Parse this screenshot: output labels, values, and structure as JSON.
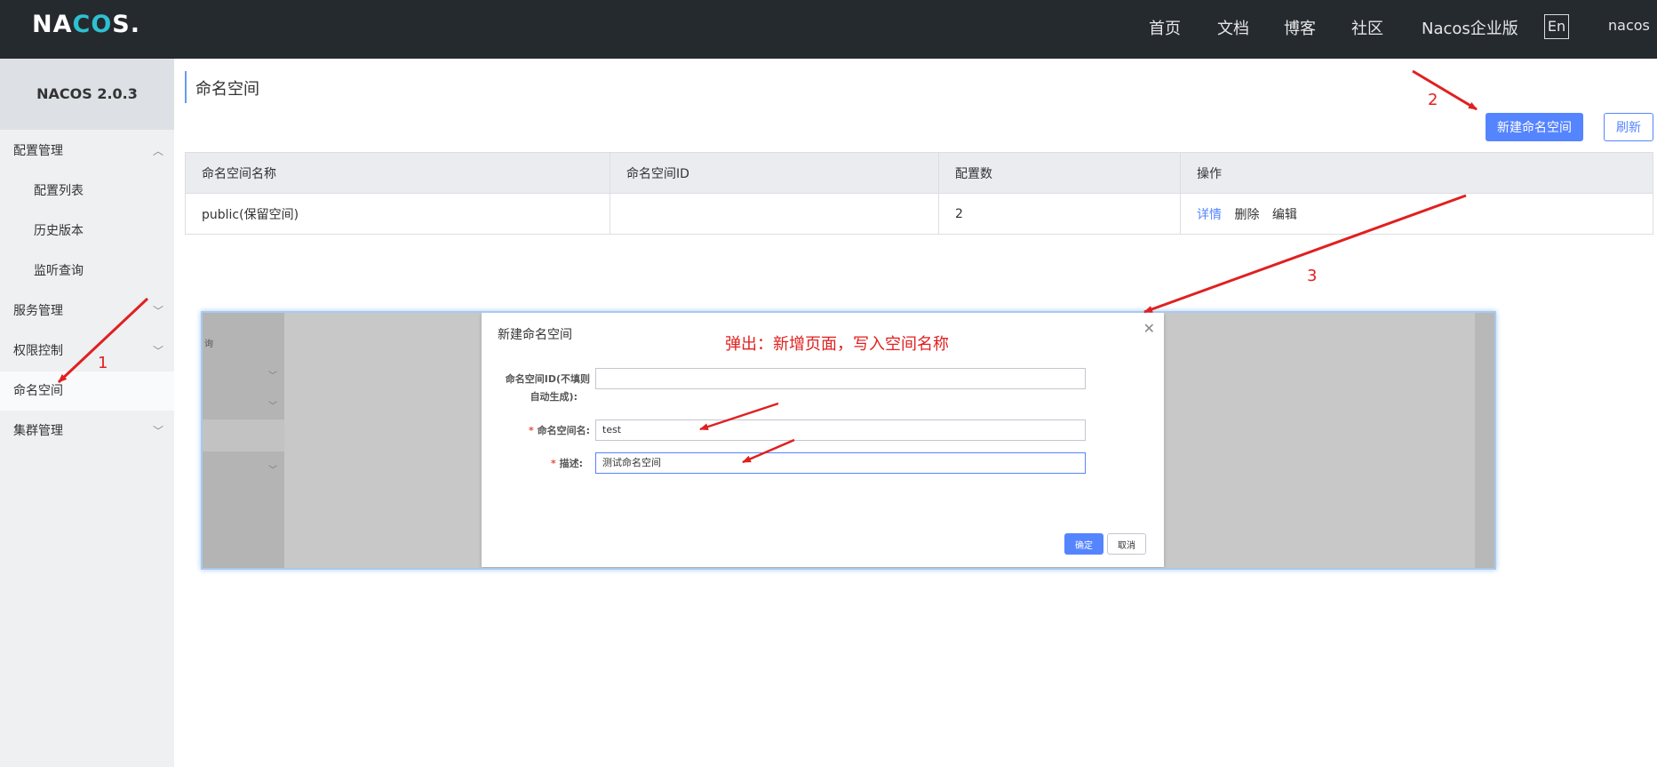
{
  "topbar": {
    "logo_main": "NA",
    "logo_accent": "CO",
    "logo_tail": "S.",
    "nav": [
      "首页",
      "文档",
      "博客",
      "社区",
      "Nacos企业版"
    ],
    "lang": "En",
    "user": "nacos"
  },
  "sidebar": {
    "version": "NACOS 2.0.3",
    "items": [
      {
        "label": "配置管理"
      },
      {
        "label": "配置列表"
      },
      {
        "label": "历史版本"
      },
      {
        "label": "监听查询"
      },
      {
        "label": "服务管理"
      },
      {
        "label": "权限控制"
      },
      {
        "label": "命名空间"
      },
      {
        "label": "集群管理"
      }
    ]
  },
  "main": {
    "title": "命名空间",
    "create_button": "新建命名空间",
    "refresh_button": "刷新",
    "table": {
      "headers": [
        "命名空间名称",
        "命名空间ID",
        "配置数",
        "操作"
      ],
      "rows": [
        {
          "name": "public(保留空间)",
          "id": "",
          "count": "2",
          "ops": [
            "详情",
            "删除",
            "编辑"
          ]
        }
      ]
    }
  },
  "dialog": {
    "title": "新建命名空间",
    "close_icon": "close-icon",
    "fields": {
      "id_label_line1": "命名空间ID(不填则",
      "id_label_line2": "自动生成):",
      "id_value": "",
      "name_label": "命名空间名:",
      "name_value": "test",
      "desc_label": "描述:",
      "desc_value": "测试命名空间"
    },
    "ok": "确定",
    "cancel": "取消",
    "side_fragment": "询"
  },
  "annotations": {
    "note": "弹出：新增页面，写入空间名称",
    "step1": "1",
    "step2": "2",
    "step3": "3",
    "color": "#e02020"
  }
}
